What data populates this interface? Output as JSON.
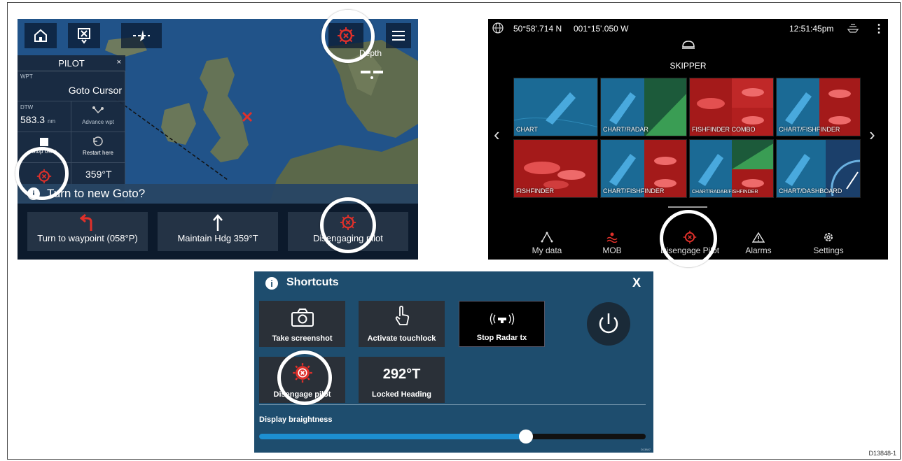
{
  "figure_id": "D13848-1",
  "panel1": {
    "map_label_depth": "Depth",
    "pilot": {
      "title": "PILOT",
      "close": "×",
      "wpt_label": "WPT",
      "wpt_value": "Goto Cursor",
      "dtw_label": "DTW",
      "dtw_value": "583.3",
      "dtw_unit": "nm",
      "advance_wpt": "Advance wpt",
      "stop_goto": "Stop Goto",
      "restart_here": "Restart here",
      "heading": "359°T"
    },
    "prompt": "Turn to new Goto?",
    "buttons": [
      {
        "label": "Turn to waypoint (058°P)"
      },
      {
        "label": "Maintain Hdg 359°T"
      },
      {
        "label": "Disengaging pilot"
      }
    ]
  },
  "panel2": {
    "latitude": "50°58'.714 N",
    "longitude": "001°15'.050 W",
    "time": "12:51:45pm",
    "profile": "SKIPPER",
    "tiles": [
      {
        "label": "CHART"
      },
      {
        "label": "CHART/RADAR"
      },
      {
        "label": "FISHFINDER COMBO"
      },
      {
        "label": "CHART/FISHFINDER"
      },
      {
        "label": "FISHFINDER"
      },
      {
        "label": "CHART/FISHFINDER"
      },
      {
        "label": "CHART/RADAR/FISHFINDER"
      },
      {
        "label": "CHART/DASHBOARD"
      }
    ],
    "nav": [
      {
        "label": "My data"
      },
      {
        "label": "MOB"
      },
      {
        "label": "Disengage Pilot"
      },
      {
        "label": "Alarms"
      },
      {
        "label": "Settings"
      }
    ]
  },
  "panel3": {
    "title": "Shortcuts",
    "close": "X",
    "shortcuts": [
      {
        "label": "Take screenshot"
      },
      {
        "label": "Activate touchlock"
      },
      {
        "label": "Stop Radar tx"
      },
      {
        "label": "Disengage pilot"
      },
      {
        "label": "Locked Heading",
        "value": "292°T"
      }
    ],
    "brightness_label": "Display braightness",
    "brightness_level": 0.69,
    "small_code": "D13847"
  },
  "colors": {
    "map_water": "#1d4f86",
    "land": "#5f6b4e",
    "alert_red": "#e0302a",
    "shortcut_bg": "#1e4d6e",
    "slider_fill": "#1d8fd1"
  }
}
